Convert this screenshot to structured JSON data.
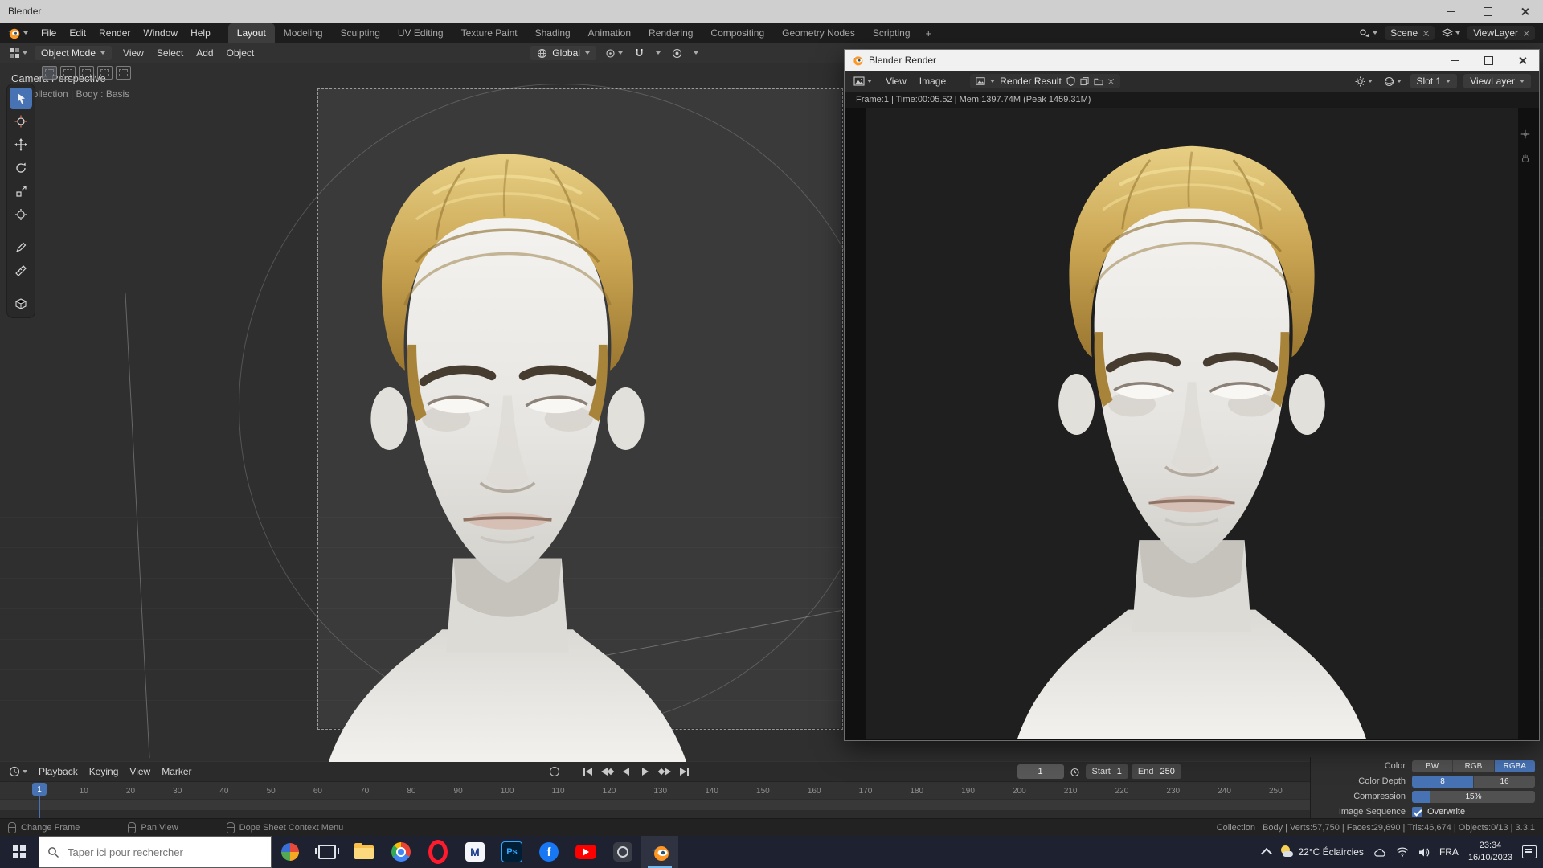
{
  "os": {
    "main_title": "Blender",
    "render_title": "Blender Render"
  },
  "topbar": {
    "menus": [
      "File",
      "Edit",
      "Render",
      "Window",
      "Help"
    ],
    "workspaces": [
      {
        "label": "Layout",
        "active": true
      },
      {
        "label": "Modeling"
      },
      {
        "label": "Sculpting"
      },
      {
        "label": "UV Editing"
      },
      {
        "label": "Texture Paint"
      },
      {
        "label": "Shading"
      },
      {
        "label": "Animation"
      },
      {
        "label": "Rendering"
      },
      {
        "label": "Compositing"
      },
      {
        "label": "Geometry Nodes"
      },
      {
        "label": "Scripting"
      }
    ],
    "add_workspace": "+",
    "scene_name": "Scene",
    "viewlayer_name": "ViewLayer"
  },
  "viewport": {
    "mode": "Object Mode",
    "menus": [
      "View",
      "Select",
      "Add",
      "Object"
    ],
    "orientation": "Global",
    "overlay_line1": "Camera Perspective",
    "overlay_line2": "(1) Collection | Body : Basis"
  },
  "render_window": {
    "menus": [
      "View",
      "Image"
    ],
    "datablock": "Render Result",
    "slot": "Slot 1",
    "viewlayer": "ViewLayer",
    "stats": "Frame:1 | Time:00:05.52 | Mem:1397.74M (Peak 1459.31M)"
  },
  "timeline": {
    "menus": [
      "Playback",
      "Keying",
      "View",
      "Marker"
    ],
    "frame_labels": [
      "1",
      "10",
      "20",
      "30",
      "40",
      "50",
      "60",
      "70",
      "80",
      "90",
      "100",
      "110",
      "120",
      "130",
      "140",
      "150",
      "160",
      "170",
      "180",
      "190",
      "200",
      "210",
      "220",
      "230",
      "240",
      "250"
    ],
    "current_frame": "1",
    "frame_field": "1",
    "start_label": "Start",
    "start_value": "1",
    "end_label": "End",
    "end_value": "250"
  },
  "output_props": {
    "color_label": "Color",
    "color_options": [
      "BW",
      "RGB",
      "RGBA"
    ],
    "color_selected": "RGBA",
    "depth_label": "Color Depth",
    "depth_options": [
      "8",
      "16"
    ],
    "depth_selected": "8",
    "compression_label": "Compression",
    "compression_value": "15%",
    "sequence_label": "Image Sequence",
    "overwrite_label": "Overwrite"
  },
  "statusbar": {
    "hints": [
      "Change Frame",
      "Pan View",
      "Dope Sheet Context Menu"
    ],
    "stats": "Collection | Body | Verts:57,750 | Faces:29,690 | Tris:46,674 | Objects:0/13 | 3.3.1"
  },
  "taskbar": {
    "search_placeholder": "Taper ici pour rechercher",
    "glyphs": {
      "photoshop": "Ps",
      "mail": "M",
      "facebook": "f"
    },
    "weather": "22°C Éclaircies",
    "language": "FRA",
    "time": "23:34",
    "date": "16/10/2023"
  },
  "colors": {
    "accent": "#4772b3",
    "blender_orange": "#ff9722"
  },
  "icons": {
    "blender-logo": "orange blender disc",
    "search": "magnifier",
    "magnet": "snap magnet",
    "camera-frame": "dashed rectangle",
    "playhead": "blue frame marker"
  }
}
